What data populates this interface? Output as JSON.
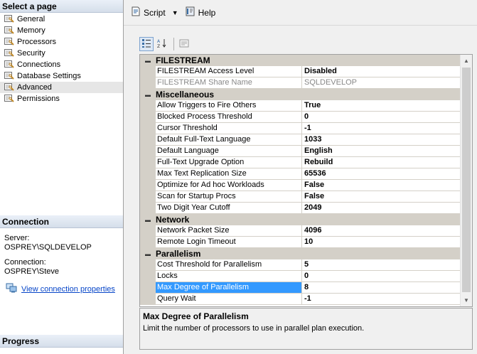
{
  "left": {
    "select_page_header": "Select a page",
    "pages": [
      {
        "label": "General",
        "active": false
      },
      {
        "label": "Memory",
        "active": false
      },
      {
        "label": "Processors",
        "active": false
      },
      {
        "label": "Security",
        "active": false
      },
      {
        "label": "Connections",
        "active": false
      },
      {
        "label": "Database Settings",
        "active": false
      },
      {
        "label": "Advanced",
        "active": true
      },
      {
        "label": "Permissions",
        "active": false
      }
    ],
    "connection_header": "Connection",
    "server_label": "Server:",
    "server_value": "OSPREY\\SQLDEVELOP",
    "connection_label": "Connection:",
    "connection_value": "OSPREY\\Steve",
    "view_connection_link": "View connection properties",
    "progress_header": "Progress"
  },
  "toolbar": {
    "script_label": "Script",
    "help_label": "Help"
  },
  "grid": {
    "categories": [
      {
        "name": "FILESTREAM",
        "rows": [
          {
            "name": "FILESTREAM Access Level",
            "value": "Disabled"
          },
          {
            "name": "FILESTREAM Share Name",
            "value": "SQLDEVELOP",
            "disabled": true
          }
        ]
      },
      {
        "name": "Miscellaneous",
        "rows": [
          {
            "name": "Allow Triggers to Fire Others",
            "value": "True"
          },
          {
            "name": "Blocked Process Threshold",
            "value": "0"
          },
          {
            "name": "Cursor Threshold",
            "value": "-1"
          },
          {
            "name": "Default Full-Text Language",
            "value": "1033"
          },
          {
            "name": "Default Language",
            "value": "English"
          },
          {
            "name": "Full-Text Upgrade Option",
            "value": "Rebuild"
          },
          {
            "name": "Max Text Replication Size",
            "value": "65536"
          },
          {
            "name": "Optimize for Ad hoc Workloads",
            "value": "False"
          },
          {
            "name": "Scan for Startup Procs",
            "value": "False"
          },
          {
            "name": "Two Digit Year Cutoff",
            "value": "2049"
          }
        ]
      },
      {
        "name": "Network",
        "rows": [
          {
            "name": "Network Packet Size",
            "value": "4096"
          },
          {
            "name": "Remote Login Timeout",
            "value": "10"
          }
        ]
      },
      {
        "name": "Parallelism",
        "rows": [
          {
            "name": "Cost Threshold for Parallelism",
            "value": "5"
          },
          {
            "name": "Locks",
            "value": "0"
          },
          {
            "name": "Max Degree of Parallelism",
            "value": "8",
            "selected": true
          },
          {
            "name": "Query Wait",
            "value": "-1"
          }
        ]
      }
    ]
  },
  "description": {
    "title": "Max Degree of Parallelism",
    "text": "Limit the number of processors to use in parallel plan execution."
  },
  "colors": {
    "selection": "#3399ff",
    "link": "#0645c8",
    "category_bg": "#d4d0c8"
  }
}
